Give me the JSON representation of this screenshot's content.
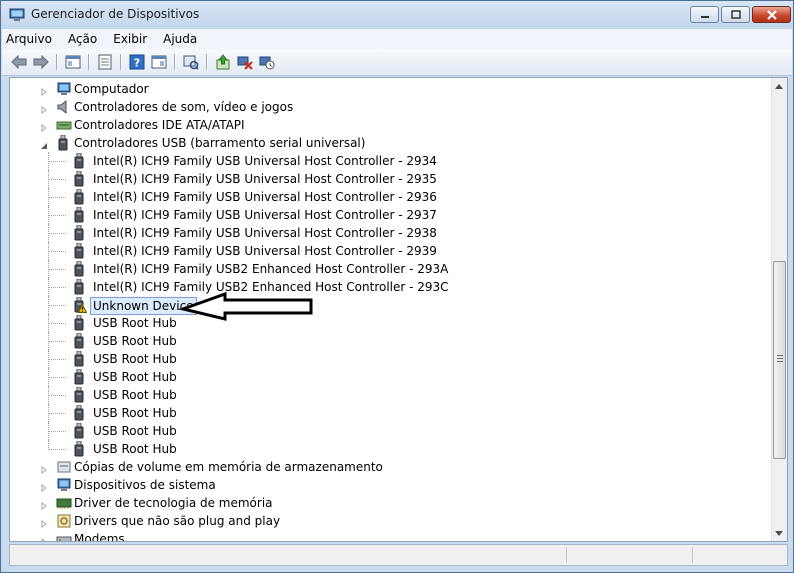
{
  "window": {
    "title": "Gerenciador de Dispositivos"
  },
  "menu": {
    "items": [
      "Arquivo",
      "Ação",
      "Exibir",
      "Ajuda"
    ]
  },
  "toolbar": {
    "icons": [
      "back-icon",
      "forward-icon",
      "properties-panel-icon",
      "list-view-icon",
      "device-view-icon",
      "help-icon",
      "resources-view-icon",
      "scan-hardware-icon",
      "update-driver-icon",
      "uninstall-device-icon",
      "disable-device-icon"
    ]
  },
  "tree": {
    "categories_before": [
      {
        "label": "Computador",
        "icon": "computer-icon"
      },
      {
        "label": "Controladores de som, vídeo e jogos",
        "icon": "speaker-icon"
      },
      {
        "label": "Controladores IDE ATA/ATAPI",
        "icon": "ide-controller-icon"
      }
    ],
    "usb": {
      "label": "Controladores USB (barramento serial universal)",
      "children": [
        "Intel(R) ICH9 Family USB Universal Host Controller - 2934",
        "Intel(R) ICH9 Family USB Universal Host Controller - 2935",
        "Intel(R) ICH9 Family USB Universal Host Controller - 2936",
        "Intel(R) ICH9 Family USB Universal Host Controller - 2937",
        "Intel(R) ICH9 Family USB Universal Host Controller - 2938",
        "Intel(R) ICH9 Family USB Universal Host Controller - 2939",
        "Intel(R) ICH9 Family USB2 Enhanced Host Controller - 293A",
        "Intel(R) ICH9 Family USB2 Enhanced Host Controller - 293C",
        "Unknown Device",
        "USB Root Hub",
        "USB Root Hub",
        "USB Root Hub",
        "USB Root Hub",
        "USB Root Hub",
        "USB Root Hub",
        "USB Root Hub",
        "USB Root Hub"
      ]
    },
    "categories_after": [
      {
        "label": "Cópias de volume em memória de armazenamento",
        "icon": "storage-volume-icon"
      },
      {
        "label": "Dispositivos de sistema",
        "icon": "system-device-icon"
      },
      {
        "label": "Driver de tecnologia de memória",
        "icon": "memory-driver-icon"
      },
      {
        "label": "Drivers que não são plug and play",
        "icon": "non-pnp-driver-icon"
      },
      {
        "label": "Modems",
        "icon": "modem-icon"
      }
    ]
  },
  "colors": {
    "selection": "#dcebfc",
    "selection_border": "#7da2ce",
    "warning": "#f2c200",
    "accent": "#1e63b4"
  }
}
